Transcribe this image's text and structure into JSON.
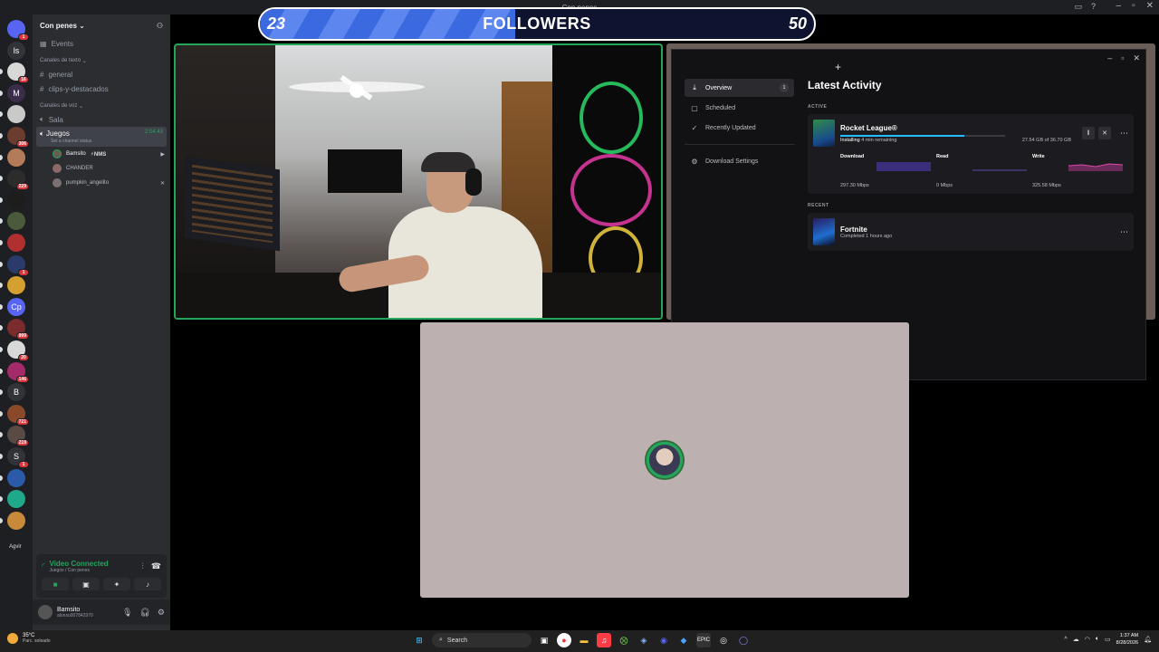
{
  "window": {
    "title": "Con penes"
  },
  "servers": [
    {
      "label": "",
      "badge": "1",
      "color": "#5865f2"
    },
    {
      "label": "ls",
      "badge": "",
      "color": "#313338"
    },
    {
      "label": "",
      "badge": "16",
      "color": "#d8d8d8"
    },
    {
      "label": "M",
      "badge": "",
      "color": "#3b2d4a"
    },
    {
      "label": "",
      "badge": "",
      "color": "#c9c9c9"
    },
    {
      "label": "",
      "badge": "306",
      "color": "#6b3d2e"
    },
    {
      "label": "",
      "badge": "",
      "color": "#b47b58"
    },
    {
      "label": "",
      "badge": "229",
      "color": "#2c2c2c"
    },
    {
      "label": "",
      "badge": "",
      "color": "#1d1d1d"
    },
    {
      "label": "",
      "badge": "",
      "color": "#4a5a3a"
    },
    {
      "label": "",
      "badge": "",
      "color": "#b03030"
    },
    {
      "label": "",
      "badge": "1",
      "color": "#2a3a6a"
    },
    {
      "label": "",
      "badge": "",
      "color": "#d4a030"
    },
    {
      "label": "Cp",
      "badge": "",
      "color": "#5865f2"
    },
    {
      "label": "",
      "badge": "999",
      "color": "#7a2b2b"
    },
    {
      "label": "",
      "badge": "20",
      "color": "#d8d8d8"
    },
    {
      "label": "",
      "badge": "146",
      "color": "#a52a6a"
    },
    {
      "label": "B",
      "badge": "",
      "color": "#313338"
    },
    {
      "label": "",
      "badge": "721",
      "color": "#8a4a2a"
    },
    {
      "label": "",
      "badge": "219",
      "color": "#5a4a44"
    },
    {
      "label": "S",
      "badge": "1",
      "color": "#313338"
    },
    {
      "label": "",
      "badge": "",
      "color": "#2a5aa8"
    },
    {
      "label": "",
      "badge": "",
      "color": "#1fa88a"
    },
    {
      "label": "",
      "badge": "",
      "color": "#c88a3a"
    }
  ],
  "server_footer": "Agvir",
  "channels": {
    "server_name": "Con penes",
    "events": "Events",
    "text_category": "Canales de texto",
    "text_channels": [
      "general",
      "clips-y-destacados"
    ],
    "voice_category": "Canales de voz",
    "voice_channels": [
      "Sala"
    ],
    "active_voice": {
      "name": "Juegos",
      "timer": "2:04:43",
      "status": "Set a channel status"
    },
    "members": [
      {
        "name": "Bamsito",
        "extra": "⚡NMS"
      },
      {
        "name": "CHANDER",
        "extra": ""
      },
      {
        "name": "pumpkin_angelito",
        "extra": ""
      }
    ]
  },
  "voice_panel": {
    "title": "Video Connected",
    "subtitle": "Juegos / Con penes"
  },
  "user": {
    "name": "Bamsito",
    "tag": "alonso007842970"
  },
  "followers": {
    "current": "23",
    "title": "FOLLOWERS",
    "goal": "50",
    "progress": 0.46
  },
  "launcher": {
    "nav": [
      {
        "label": "Overview",
        "count": "1",
        "icon": "⤓",
        "selected": true
      },
      {
        "label": "Scheduled",
        "count": "",
        "icon": "▢",
        "selected": false
      },
      {
        "label": "Recently Updated",
        "count": "",
        "icon": "✓",
        "selected": false
      }
    ],
    "settings": "Download Settings",
    "title": "Latest Activity",
    "active_label": "ACTIVE",
    "recent_label": "RECENT",
    "active": {
      "name": "Rocket League®",
      "status": "Installing",
      "remaining": "4 min remaining",
      "size": "27.54 GB of 36.70 GB",
      "progress": 0.75,
      "stats": [
        {
          "label": "Download",
          "value": "297.30 Mbps"
        },
        {
          "label": "Read",
          "value": "0 Mbps"
        },
        {
          "label": "Write",
          "value": "325.58 Mbps"
        }
      ]
    },
    "recent": {
      "name": "Fortnite",
      "status": "Completed 1 hours ago"
    }
  },
  "taskbar": {
    "weather_temp": "35°C",
    "weather_desc": "Parc. soleado",
    "search": "Search",
    "time": "1:37 AM",
    "date": "8/28/2026"
  },
  "colors": {
    "green": "#23a55a",
    "blurple": "#5865f2",
    "epic_blue": "#26bbff"
  }
}
